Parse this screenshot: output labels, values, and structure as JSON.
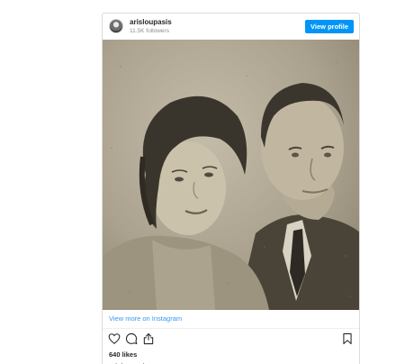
{
  "post": {
    "username": "arisloupasis",
    "followers": "11.5K followers",
    "view_profile_label": "View profile",
    "view_more_label": "View more on Instagram",
    "likes": "640 likes",
    "caption_username": "arisloupasis"
  },
  "icons": {
    "like": "heart-icon",
    "comment": "comment-icon",
    "share": "share-icon",
    "save": "bookmark-icon"
  },
  "colors": {
    "accent": "#0095f6",
    "link": "#3897f0",
    "photo_tone": "#a8a08c"
  }
}
